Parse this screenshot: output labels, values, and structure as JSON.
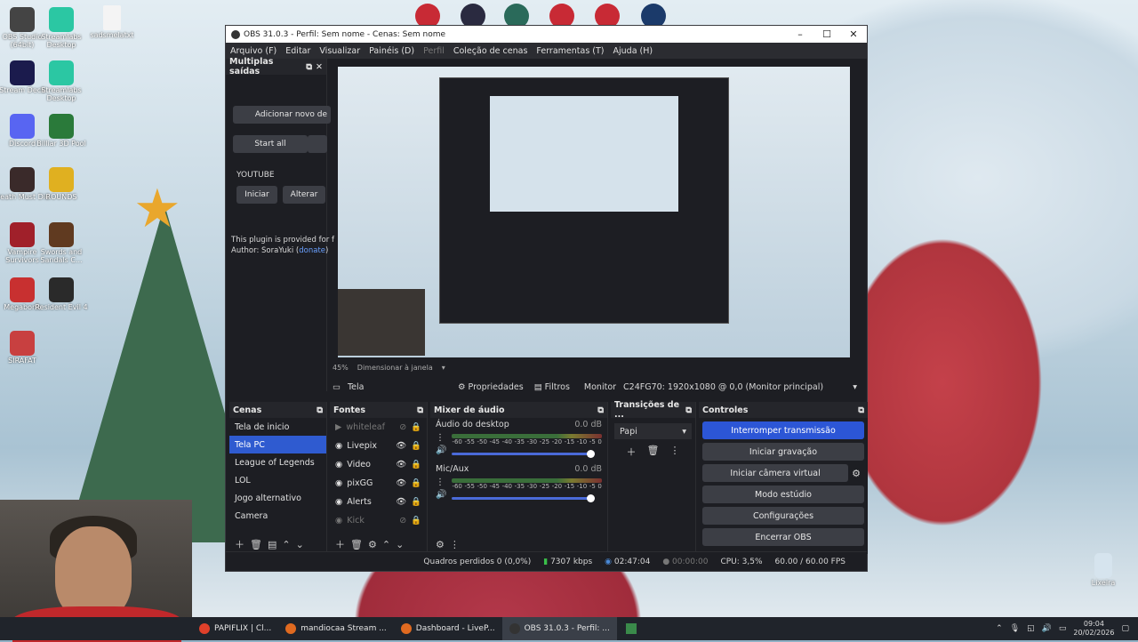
{
  "desktop": {
    "icons": [
      {
        "label": "OBS Studio (64bit)",
        "color": "#444"
      },
      {
        "label": "Streamlabs Desktop",
        "color": "#2bc7a3"
      },
      {
        "label": "Stream Deck",
        "color": "#1b1b4d"
      },
      {
        "label": "Streamlabs Desktop",
        "color": "#2bc7a3"
      },
      {
        "label": "Discord",
        "color": "#5865f2"
      },
      {
        "label": "Billiar 3D Pool",
        "color": "#2a7a3a"
      },
      {
        "label": "Death Must Die",
        "color": "#3a2a2a"
      },
      {
        "label": "ROUNDS",
        "color": "#e0b020"
      },
      {
        "label": "Vampire Survivors",
        "color": "#a0202a"
      },
      {
        "label": "Swords and Sandals C...",
        "color": "#603a20"
      },
      {
        "label": "Megabonk",
        "color": "#c83030"
      },
      {
        "label": "Resident Evil 4",
        "color": "#2a2a2a"
      },
      {
        "label": "SIRAFAT",
        "color": "#c84040"
      }
    ],
    "file_icon": "sadsmelatxt",
    "recycle": "Lixeira"
  },
  "taskbar": {
    "items": [
      {
        "label": "PAPIFLIX | Cl...",
        "color": "#e0402a"
      },
      {
        "label": "mandiocaa Stream ...",
        "color": "#e06a20"
      },
      {
        "label": "Dashboard - LiveP...",
        "color": "#e06a20"
      },
      {
        "label": "OBS 31.0.3 - Perfil: ...",
        "color": "#333"
      }
    ],
    "time": "09:04",
    "date": "20/02/2026"
  },
  "window": {
    "title": "OBS 31.0.3 - Perfil: Sem nome - Cenas: Sem nome",
    "menu": [
      "Arquivo (F)",
      "Editar",
      "Visualizar",
      "Painéis (D)",
      "Perfil",
      "Coleção de cenas",
      "Ferramentas (T)",
      "Ajuda (H)"
    ]
  },
  "multi_output": {
    "title": "Multiplas saídas",
    "add_label": "Adicionar novo de",
    "start_all": "Start all",
    "platform": "YOUTUBE",
    "start": "Iniciar",
    "edit": "Alterar",
    "info": "This plugin is provided for f",
    "author": "Author: SoraYuki (",
    "donate": "donate",
    "author_end": ")"
  },
  "preview": {
    "zoom": "45%",
    "scale_mode": "Dimensionar à janela"
  },
  "source_bar": {
    "source": "Tela",
    "properties": "Propriedades",
    "filters": "Filtros",
    "monitor_label": "Monitor",
    "monitor_value": "C24FG70: 1920x1080 @ 0,0 (Monitor principal)"
  },
  "scenes": {
    "title": "Cenas",
    "items": [
      "Tela de inicio",
      "Tela PC",
      "League of Legends",
      "LOL",
      "Jogo alternativo",
      "Camera"
    ],
    "selected": 1
  },
  "sources": {
    "title": "Fontes",
    "items": [
      {
        "label": "whiteleaf",
        "hidden": true
      },
      {
        "label": "Livepix",
        "hidden": false
      },
      {
        "label": "Video",
        "hidden": false
      },
      {
        "label": "pixGG",
        "hidden": false
      },
      {
        "label": "Alerts",
        "hidden": false
      },
      {
        "label": "Kick",
        "hidden": true
      }
    ]
  },
  "audio": {
    "title": "Mixer de áudio",
    "channels": [
      {
        "name": "Áudio do desktop",
        "db": "0.0 dB",
        "muted": true,
        "level": 0.95
      },
      {
        "name": "Mic/Aux",
        "db": "0.0 dB",
        "muted": false,
        "level": 0.95
      }
    ],
    "scale": [
      "-60",
      "-55",
      "-50",
      "-45",
      "-40",
      "-35",
      "-30",
      "-25",
      "-20",
      "-15",
      "-10",
      "-5",
      "0"
    ]
  },
  "transitions": {
    "title": "Transições de ...",
    "value": "Papi"
  },
  "controls": {
    "title": "Controles",
    "buttons": [
      "Interromper transmissão",
      "Iniciar gravação",
      "Iniciar câmera virtual",
      "Modo estúdio",
      "Configurações",
      "Encerrar OBS"
    ]
  },
  "status": {
    "dropped": "Quadros perdidos 0 (0,0%)",
    "bitrate": "7307 kbps",
    "stream_time": "02:47:04",
    "rec_time": "00:00:00",
    "cpu": "CPU: 3,5%",
    "fps": "60.00 / 60.00 FPS"
  },
  "colors": {
    "accent": "#2c56d6",
    "selection": "#2f5bd0",
    "panel": "#1d1e23"
  }
}
